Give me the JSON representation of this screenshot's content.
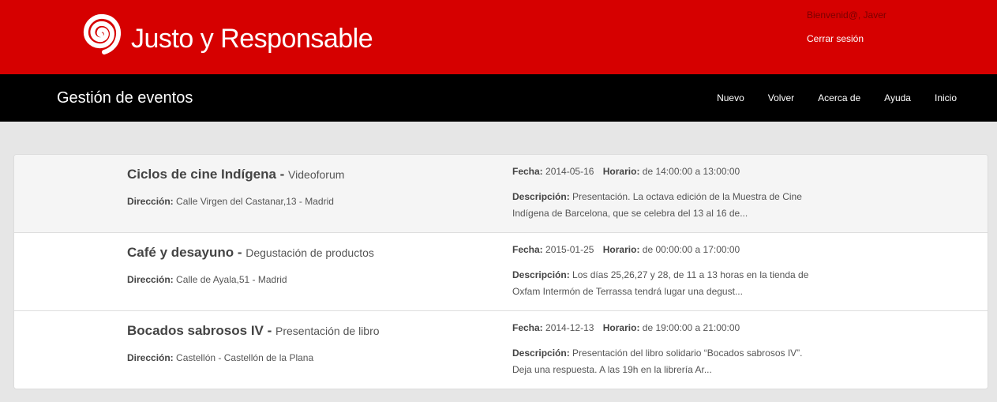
{
  "header": {
    "brand": "Justo y Responsable",
    "welcome": "Bienvenid@, Javer",
    "logout": "Cerrar sesión",
    "brand_color": "#d60000"
  },
  "navbar": {
    "title": "Gestión de eventos",
    "links": [
      "Nuevo",
      "Volver",
      "Acerca de",
      "Ayuda",
      "Inicio"
    ]
  },
  "labels": {
    "direccion": "Dirección:",
    "fecha": "Fecha:",
    "horario": "Horario:",
    "descripcion": "Descripción:",
    "title_sep": " - "
  },
  "events": [
    {
      "name": "Ciclos de cine Indígena",
      "category": "Videoforum",
      "direccion": "Calle Virgen del Castanar,13 - Madrid",
      "fecha": "2014-05-16",
      "horario": "de 14:00:00 a 13:00:00",
      "descripcion": "Presentación. La octava edición de la Muestra de Cine Indígena de Barcelona, que se celebra del 13 al 16 de..."
    },
    {
      "name": "Café y desayuno",
      "category": "Degustación de productos",
      "direccion": "Calle de Ayala,51 - Madrid",
      "fecha": "2015-01-25",
      "horario": "de 00:00:00 a 17:00:00",
      "descripcion": "Los días 25,26,27 y 28, de 11 a 13 horas en la tienda de Oxfam Intermón de Terrassa tendrá lugar una degust..."
    },
    {
      "name": "Bocados sabrosos IV",
      "category": "Presentación de libro",
      "direccion": "Castellón - Castellón de la Plana",
      "fecha": "2014-12-13",
      "horario": "de 19:00:00 a 21:00:00",
      "descripcion": "Presentación del libro solidario “Bocados sabrosos IV”. Deja una respuesta. A las 19h en la librería Ar..."
    }
  ]
}
